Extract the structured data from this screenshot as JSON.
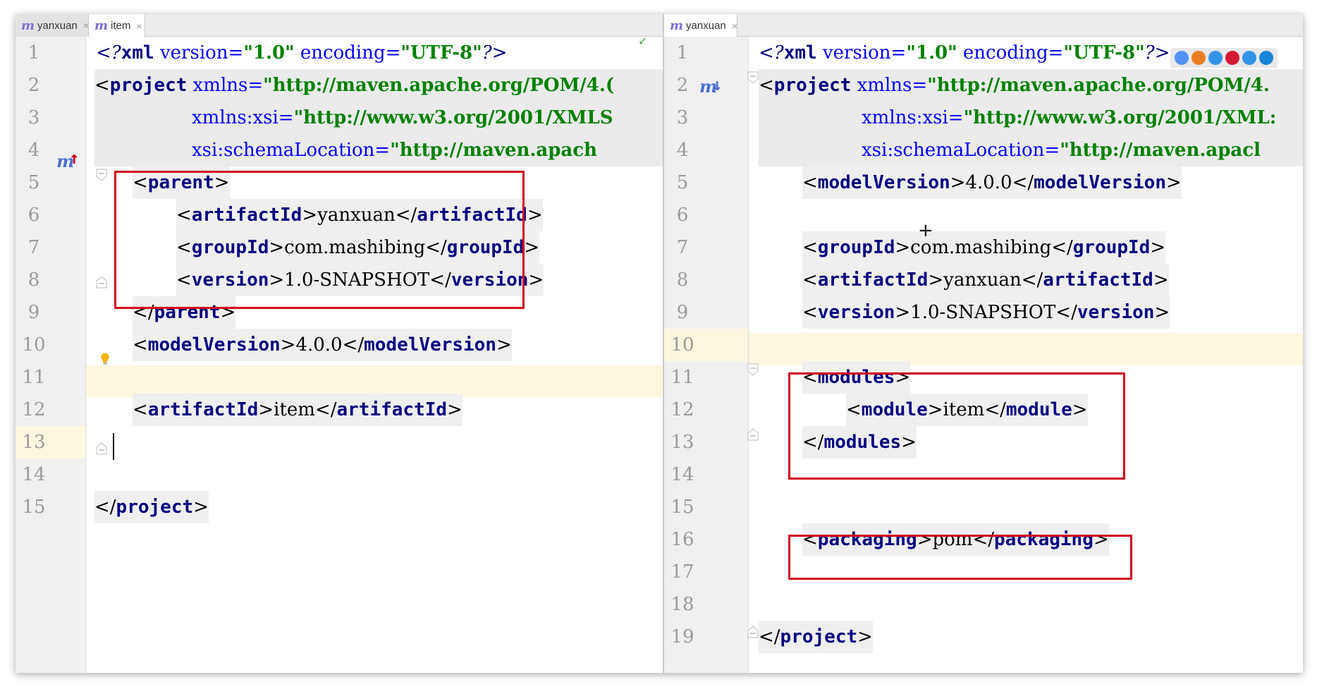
{
  "left_editor": {
    "tabs": [
      {
        "label": "yanxuan",
        "close": "×",
        "active": false
      },
      {
        "label": "item",
        "close": "×",
        "active": true
      }
    ],
    "line_numbers": [
      "1",
      "2",
      "3",
      "4",
      "5",
      "6",
      "7",
      "8",
      "9",
      "10",
      "11",
      "12",
      "13",
      "14",
      "15"
    ],
    "lines": {
      "l1": {
        "open": "<?",
        "tag": "xml",
        "a1": " version=",
        "v1": "\"1.0\"",
        "a2": " encoding=",
        "v2": "\"UTF-8\"",
        "close": "?>"
      },
      "l2": {
        "lt": "<",
        "tag": "project",
        "attr": " xmlns=",
        "val": "\"http://maven.apache.org/POM/4.("
      },
      "l3": {
        "attr": "xmlns:xsi=",
        "val": "\"http://www.w3.org/2001/XMLS"
      },
      "l4": {
        "attr": "xsi:schemaLocation=",
        "val": "\"http://maven.apach"
      },
      "l5": {
        "tag": "parent"
      },
      "l6": {
        "tag": "artifactId",
        "text": "yanxuan"
      },
      "l7": {
        "tag": "groupId",
        "text": "com.mashibing"
      },
      "l8": {
        "tag": "version",
        "text": "1.0-SNAPSHOT"
      },
      "l9": {
        "tag": "parent"
      },
      "l10": {
        "tag": "modelVersion",
        "text": "4.0.0"
      },
      "l12": {
        "tag": "artifactId",
        "text": "item"
      },
      "l15": {
        "tag": "project"
      }
    }
  },
  "right_editor": {
    "tabs": [
      {
        "label": "yanxuan",
        "close": "×",
        "active": true
      }
    ],
    "line_numbers": [
      "1",
      "2",
      "3",
      "4",
      "5",
      "6",
      "7",
      "8",
      "9",
      "10",
      "11",
      "12",
      "13",
      "14",
      "15",
      "16",
      "17",
      "18",
      "19"
    ],
    "lines": {
      "l1": {
        "open": "<?",
        "tag": "xml",
        "a1": " version=",
        "v1": "\"1.0\"",
        "a2": " encoding=",
        "v2": "\"UTF-8\"",
        "close": "?>"
      },
      "l2": {
        "lt": "<",
        "tag": "project",
        "attr": " xmlns=",
        "val": "\"http://maven.apache.org/POM/4."
      },
      "l3": {
        "attr": "xmlns:xsi=",
        "val": "\"http://www.w3.org/2001/XML:"
      },
      "l4": {
        "attr": "xsi:schemaLocation=",
        "val": "\"http://maven.apacl"
      },
      "l5": {
        "tag": "modelVersion",
        "text": "4.0.0"
      },
      "l7": {
        "tag": "groupId",
        "text": "com.mashibing"
      },
      "l8": {
        "tag": "artifactId",
        "text": "yanxuan"
      },
      "l9": {
        "tag": "version",
        "text": "1.0-SNAPSHOT"
      },
      "l11": {
        "tag": "modules"
      },
      "l12": {
        "tag": "module",
        "text": "item"
      },
      "l13": {
        "tag": "modules"
      },
      "l16": {
        "tag": "packaging",
        "text": "pom"
      },
      "l19": {
        "tag": "project"
      }
    }
  },
  "icons": {
    "maven": "m",
    "override_up": "↑",
    "implemented_down": "↓",
    "check": "✓",
    "crosshair": "+"
  },
  "colors": {
    "highlight_box": "#d0021b",
    "current_line": "#fdf7e0",
    "tag": "#000080",
    "string": "#008000",
    "attribute": "#0000ff",
    "browser_icons": [
      "#4285f4",
      "#e8710a",
      "#1e88e5",
      "#d0021b",
      "#1e88e5",
      "#0078d7"
    ]
  }
}
